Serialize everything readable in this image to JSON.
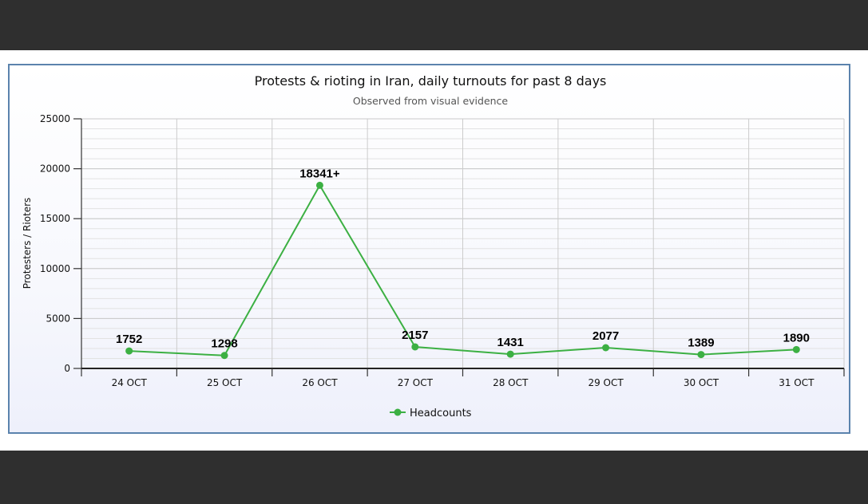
{
  "chart_data": {
    "type": "line",
    "title": "Protests & rioting in Iran, daily turnouts for past 8 days",
    "subtitle": "Observed from visual evidence",
    "ylabel": "Protesters / Rioters",
    "xlabel": "",
    "categories": [
      "24 OCT",
      "25 OCT",
      "26 OCT",
      "27 OCT",
      "28 OCT",
      "29 OCT",
      "30 OCT",
      "31 OCT"
    ],
    "series": [
      {
        "name": "Headcounts",
        "values": [
          1752,
          1298,
          18341,
          2157,
          1431,
          2077,
          1389,
          1890
        ],
        "labels": [
          "1752",
          "1298",
          "18341+",
          "2157",
          "1431",
          "2077",
          "1389",
          "1890"
        ],
        "color": "#3cb043"
      }
    ],
    "ylim": [
      0,
      25000
    ],
    "yticks": [
      0,
      5000,
      10000,
      15000,
      20000,
      25000
    ],
    "ytick_labels": [
      "0",
      "5000",
      "10000",
      "15000",
      "20000",
      "25000"
    ],
    "grid": true,
    "legend_position": "bottom-center"
  }
}
